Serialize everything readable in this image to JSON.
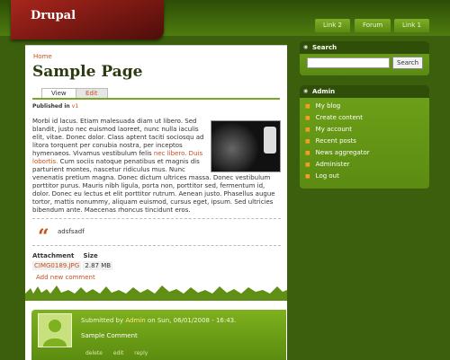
{
  "site": {
    "name": "Drupal"
  },
  "top_tabs": [
    "Link 2",
    "Forum",
    "Link 1"
  ],
  "breadcrumb": "Home",
  "page": {
    "title": "Sample Page",
    "tabs": {
      "view": "View",
      "edit": "Edit"
    },
    "published_label": "Published in",
    "published_value": "v1",
    "body_part1": "Morbi id lacus. Etiam malesuada diam ut libero. Sed blandit, justo nec euismod laoreet, nunc nulla iaculis elit, vitae. Donec dolor. Class aptent taciti sociosqu ad litora torquent per conubia nostra, per inceptos hymenaeos. Vivamus vestibulum felis ",
    "body_link": "nec libero. Duis lobortis.",
    "body_part2": " Cum sociis natoque penatibus et magnis dis parturient montes, nascetur ridiculus mus. Nunc venenatis pretium magna. Donec dictum ultrices massa. Donec vestibulum porttitor purus. Mauris nibh ligula, porta non, porttitor sed, fermentum id, dolor. Donec eu lectus et elit porttitor rutrum. Aenean justo. Phasellus augue tortor, mattis nonummy, aliquam euismod, cursus eget, ipsum. Sed ultricies bibendum ante. Maecenas rhoncus tincidunt eros.",
    "quote": "adsfsadf",
    "attachments": {
      "header_file": "Attachment",
      "header_size": "Size",
      "file": "CIMG0189.JPG",
      "size": "2.87 MB"
    },
    "add_comment": "Add new comment"
  },
  "comment": {
    "meta_prefix": "Submitted by",
    "author": "Admin",
    "meta_suffix": "on Sun, 06/01/2008 - 16:43.",
    "text": "Sample Comment",
    "actions": [
      "delete",
      "edit",
      "reply"
    ]
  },
  "search_block": {
    "title": "Search",
    "button": "Search",
    "value": ""
  },
  "admin_block": {
    "title": "Admin",
    "items": [
      "My blog",
      "Create content",
      "My account",
      "Recent posts",
      "News aggregator",
      "Administer",
      "Log out"
    ]
  },
  "colors": {
    "accent": "#c8501a",
    "green": "#6fa219",
    "dark_green": "#2f4f08",
    "brand_red": "#8b1a12"
  }
}
